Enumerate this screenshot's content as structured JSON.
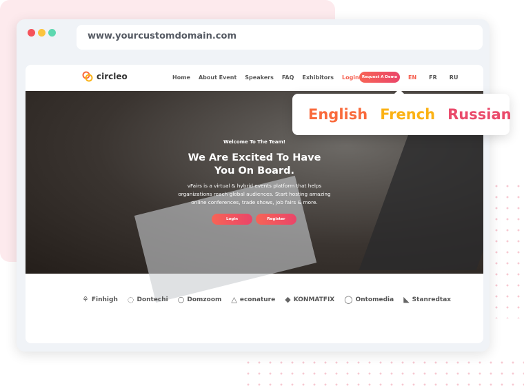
{
  "browser": {
    "url": "www.yourcustomdomain.com"
  },
  "nav": {
    "logo": "circleo",
    "items": [
      "Home",
      "About Event",
      "Speakers",
      "FAQ",
      "Exhibitors"
    ],
    "login": "Login",
    "demo": "Request A Demo",
    "langs": [
      "EN",
      "FR",
      "RU"
    ]
  },
  "hero": {
    "eyebrow": "Welcome To The Team!",
    "title_line1": "We Are Excited To Have",
    "title_line2": "You On Board.",
    "desc_line1": "vFairs is a virtual & hybrid events platform that helps",
    "desc_line2": "organizations reach global audiences. Start hosting amazing",
    "desc_line3": "online conferences, trade shows, job fairs & more.",
    "login": "Login",
    "register": "Register"
  },
  "brands": [
    {
      "name": "Finhigh",
      "icon": "⚘"
    },
    {
      "name": "Dontechi",
      "icon": "◌"
    },
    {
      "name": "Domzoom",
      "icon": "○"
    },
    {
      "name": "econature",
      "icon": "△"
    },
    {
      "name": "KONMATFIX",
      "icon": "◆"
    },
    {
      "name": "Ontomedia",
      "icon": "◯"
    },
    {
      "name": "Stanredtax",
      "icon": "◣"
    }
  ],
  "popup": {
    "languages": [
      {
        "label": "English",
        "color": "#f96a3c"
      },
      {
        "label": "French",
        "color": "#fbb215"
      },
      {
        "label": "Russian",
        "color": "#ea4a6b"
      }
    ]
  },
  "colors": {
    "accent": "#ea4569",
    "login": "#f55b4b"
  }
}
